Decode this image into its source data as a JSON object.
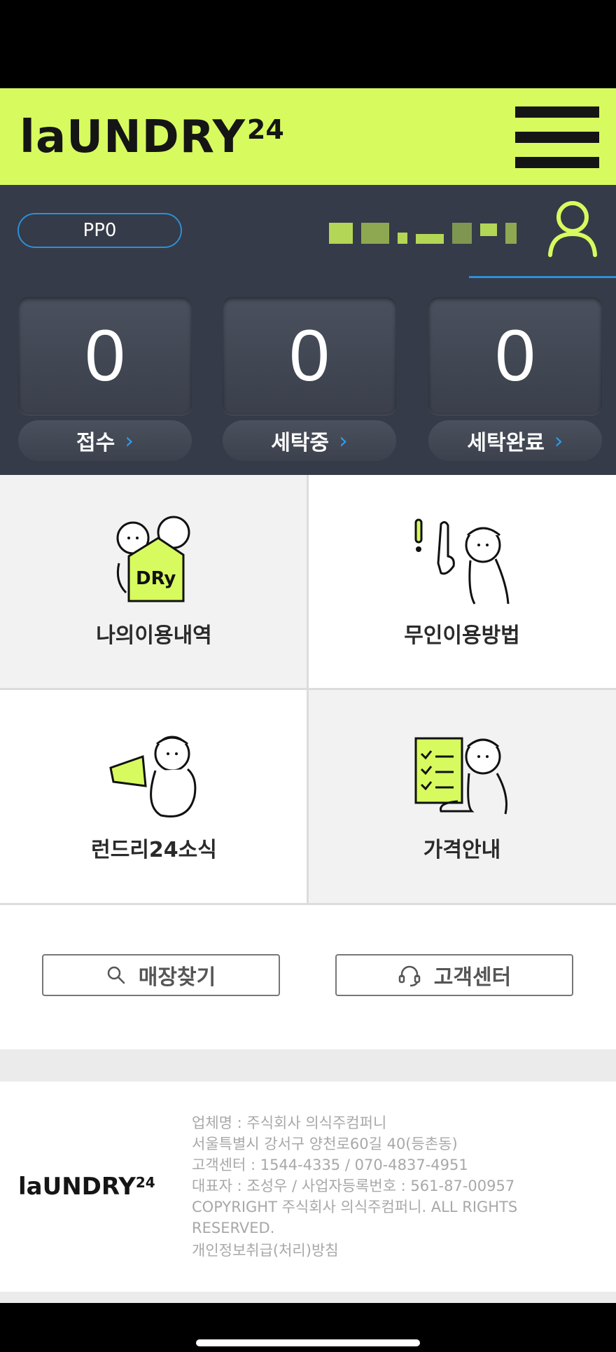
{
  "header": {
    "logo_text": "laUNDRY",
    "logo_sup": "24"
  },
  "dashboard": {
    "member_code": "PP0",
    "counters": [
      {
        "value": "0",
        "label": "접수"
      },
      {
        "value": "0",
        "label": "세탁중"
      },
      {
        "value": "0",
        "label": "세탁완료"
      }
    ],
    "chevron": "›"
  },
  "menu_grid": [
    {
      "label": "나의이용내역",
      "icon": "dry-bag-illustration-icon"
    },
    {
      "label": "무인이용방법",
      "icon": "pointing-finger-illustration-icon"
    },
    {
      "label": "런드리24소식",
      "icon": "megaphone-illustration-icon"
    },
    {
      "label": "가격안내",
      "icon": "price-checklist-illustration-icon"
    }
  ],
  "actions": {
    "store_finder": "매장찾기",
    "customer_center": "고객센터"
  },
  "footer": {
    "logo_text": "laUNDRY",
    "logo_sup": "24",
    "company": "업체명 : 주식회사 의식주컴퍼니",
    "address": "서울특별시 강서구 양천로60길 40(등촌동)",
    "phone": "고객센터 : 1544-4335 / 070-4837-4951",
    "ceo": "대표자 : 조성우 / 사업자등록번호 : 561-87-00957",
    "copyright": "COPYRIGHT 주식회사 의식주컴퍼니. ALL RIGHTS RESERVED.",
    "privacy": "개인정보취급(처리)방침"
  },
  "colors": {
    "brand_lime": "#d7fb5f",
    "dashboard_bg": "#353b48",
    "accent_blue": "#2e8fd8"
  }
}
